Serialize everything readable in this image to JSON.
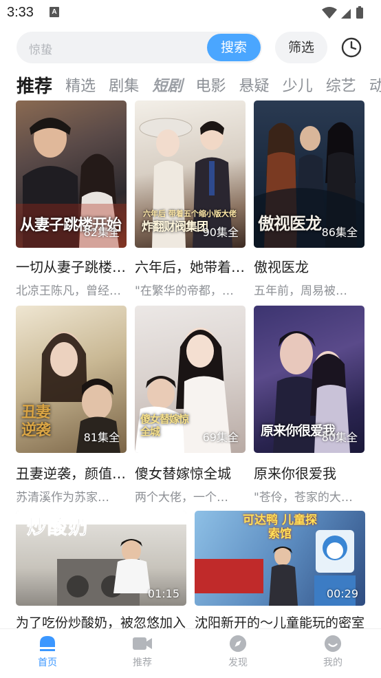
{
  "status_bar": {
    "time": "3:33",
    "notification_letter": "A"
  },
  "search": {
    "placeholder": "惊蛰",
    "button_label": "搜索"
  },
  "filter_label": "筛选",
  "tabs": [
    {
      "label": "推荐",
      "active": true
    },
    {
      "label": "精选"
    },
    {
      "label": "剧集"
    },
    {
      "label": "短剧"
    },
    {
      "label": "电影"
    },
    {
      "label": "悬疑"
    },
    {
      "label": "少儿"
    },
    {
      "label": "综艺"
    },
    {
      "label": "动漫"
    }
  ],
  "dramas": [
    {
      "title": "一切从妻子跳楼开始",
      "desc": "北凉王陈凡，曾经的…",
      "episodes": "82集全",
      "poster_text": "从妻子跳楼开始"
    },
    {
      "title": "六年后，她带着萌宝归来",
      "desc": "\"在繁华的帝都，…",
      "episodes": "90集全",
      "poster_text": "炸翻财阀集团",
      "poster_sub": "六年后 带着五个缩小版大佬"
    },
    {
      "title": "傲视医龙",
      "desc": "五年前，周易被…",
      "episodes": "86集全",
      "poster_text": "傲视医龙"
    },
    {
      "title": "丑妻逆袭，颜值惊人",
      "desc": "苏清溪作为苏家…",
      "episodes": "81集全",
      "poster_text": "丑妻逆袭"
    },
    {
      "title": "傻女替嫁惊全城",
      "desc": "两个大佬，一个…",
      "episodes": "69集全",
      "poster_text": "傻女替嫁惊全城"
    },
    {
      "title": "原来你很爱我",
      "desc": "\"苍伶，苍家的大…",
      "episodes": "80集全",
      "poster_text": "原来你很爱我"
    }
  ],
  "videos": [
    {
      "title": "为了吃份炒酸奶，被忽悠加入",
      "duration": "01:15",
      "poster_text": "炒酸奶"
    },
    {
      "title": "沈阳新开的～儿童能玩的密室",
      "duration": "00:29",
      "poster_text": "可达鸭 儿童探索馆"
    }
  ],
  "bottom_nav": [
    {
      "label": "首页",
      "icon": "home-icon",
      "active": true
    },
    {
      "label": "推荐",
      "icon": "video-icon"
    },
    {
      "label": "发现",
      "icon": "compass-icon"
    },
    {
      "label": "我的",
      "icon": "profile-icon"
    }
  ],
  "colors": {
    "accent": "#3b97ff",
    "search_button": "#4aa6ff",
    "text_primary": "#1f1f1f",
    "text_secondary": "#8d9095"
  }
}
